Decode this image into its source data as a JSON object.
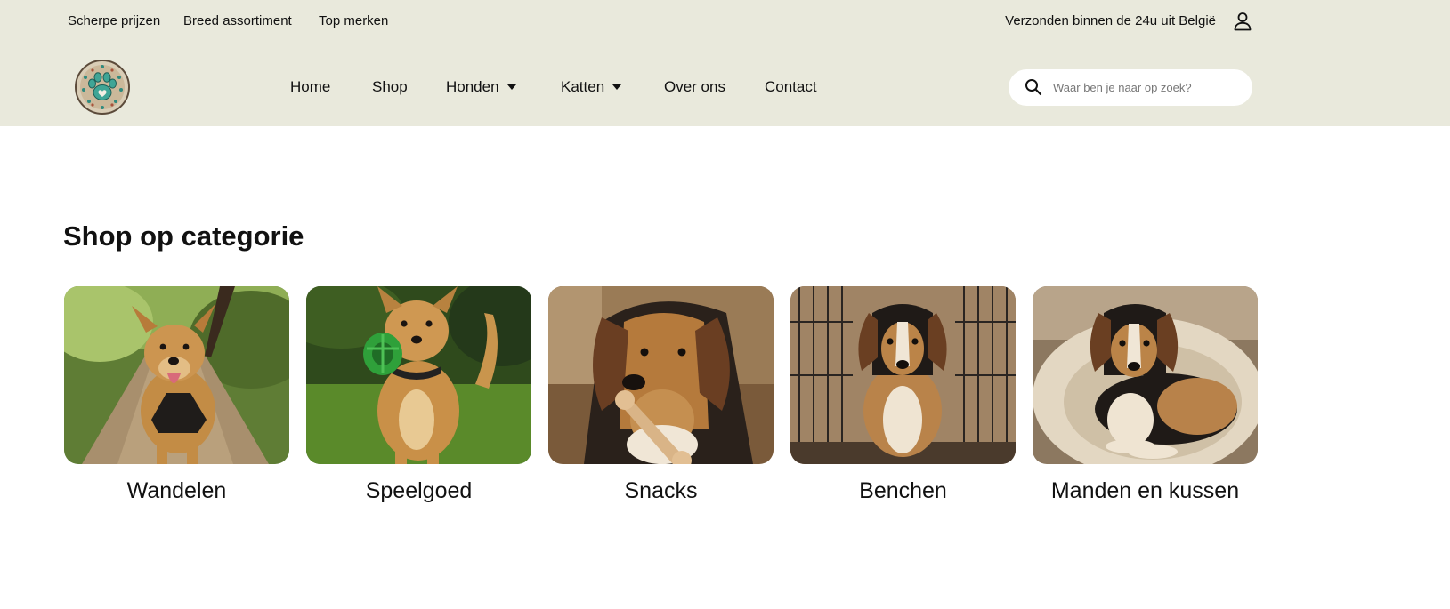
{
  "topbar": {
    "usps": [
      "Scherpe prijzen",
      "Breed assortiment",
      "Top merken"
    ],
    "shipping": "Verzonden binnen de 24u uit België",
    "account_icon": "user-icon"
  },
  "nav": {
    "items": [
      {
        "label": "Home",
        "has_dropdown": false
      },
      {
        "label": "Shop",
        "has_dropdown": false
      },
      {
        "label": "Honden",
        "has_dropdown": true
      },
      {
        "label": "Katten",
        "has_dropdown": true
      },
      {
        "label": "Over ons",
        "has_dropdown": false
      },
      {
        "label": "Contact",
        "has_dropdown": false
      }
    ]
  },
  "search": {
    "placeholder": "Waar ben je naar op zoek?",
    "value": "",
    "icon": "search-icon"
  },
  "section": {
    "title": "Shop op categorie"
  },
  "categories": [
    {
      "label": "Wandelen",
      "image": "dog-on-leash-photo"
    },
    {
      "label": "Speelgoed",
      "image": "dog-with-toy-photo"
    },
    {
      "label": "Snacks",
      "image": "dog-with-chew-photo"
    },
    {
      "label": "Benchen",
      "image": "dog-in-crate-photo"
    },
    {
      "label": "Manden en kussen",
      "image": "dog-in-bed-photo"
    }
  ],
  "colors": {
    "header_bg": "#e9e9dc",
    "text": "#111111",
    "search_bg": "#ffffff"
  }
}
